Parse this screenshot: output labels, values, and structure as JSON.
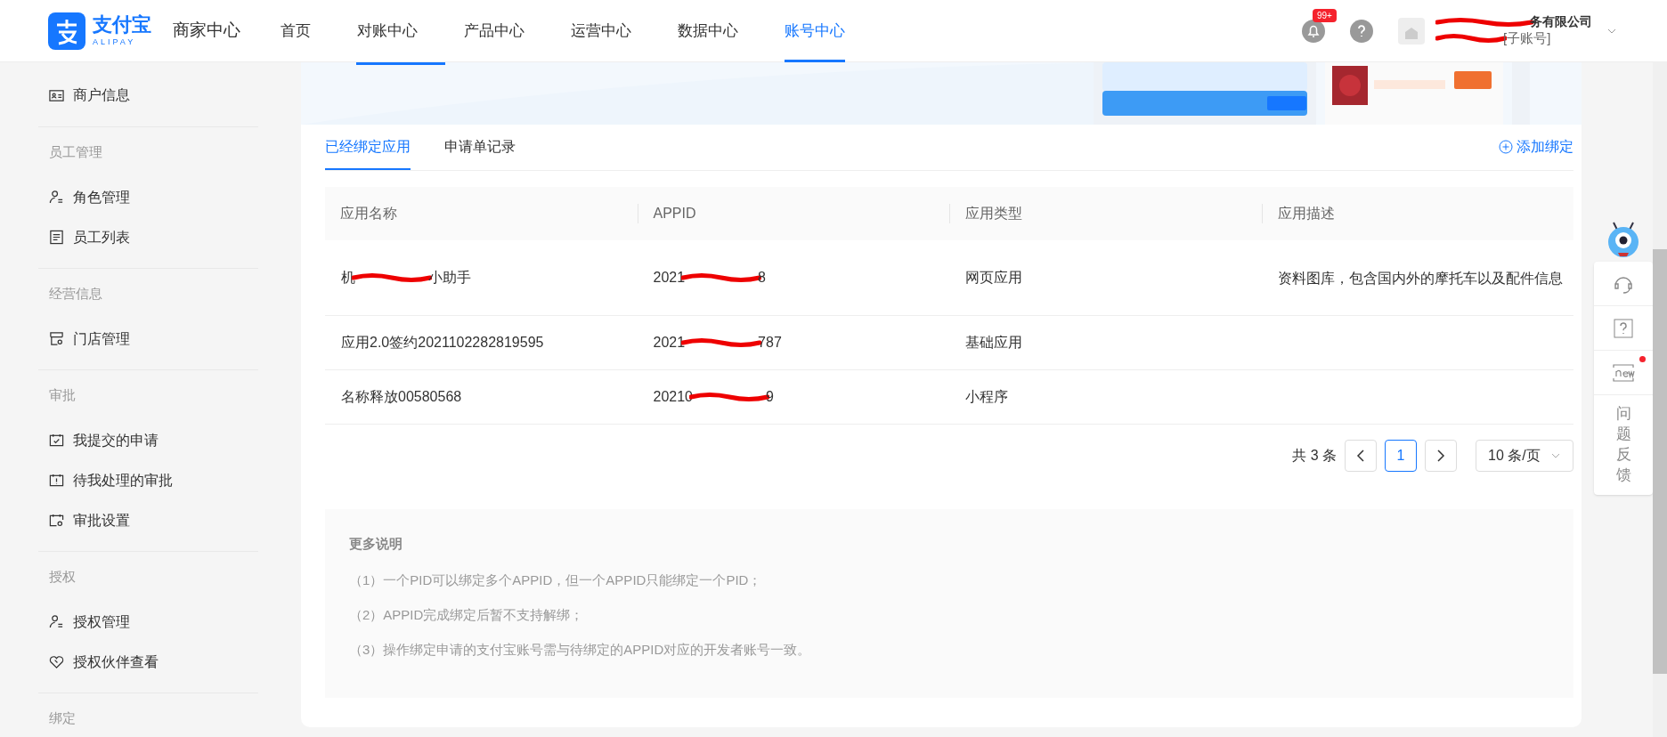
{
  "header": {
    "logo": {
      "name": "支付宝",
      "sub": "ALIPAY"
    },
    "title": "商家中心",
    "nav": [
      {
        "label": "首页",
        "selected": false
      },
      {
        "label": "对账中心",
        "selected": false
      },
      {
        "label": "产品中心",
        "selected": false
      },
      {
        "label": "运营中心",
        "selected": false
      },
      {
        "label": "数据中心",
        "selected": false
      },
      {
        "label": "账号中心",
        "selected": true
      }
    ],
    "notification_badge": "99+",
    "account": {
      "company_visible": "务有限公司",
      "role": "[子账号]"
    }
  },
  "sidebar": {
    "groups": [
      {
        "items": [
          {
            "label": "商户信息",
            "kind": "card"
          }
        ]
      },
      {
        "heading": "员工管理",
        "items": [
          {
            "label": "角色管理",
            "kind": "user"
          },
          {
            "label": "员工列表",
            "kind": "list"
          }
        ]
      },
      {
        "heading": "经营信息",
        "items": [
          {
            "label": "门店管理",
            "kind": "store"
          }
        ]
      },
      {
        "heading": "审批",
        "items": [
          {
            "label": "我提交的申请",
            "kind": "check"
          },
          {
            "label": "待我处理的审批",
            "kind": "alert"
          },
          {
            "label": "审批设置",
            "kind": "gear"
          }
        ]
      },
      {
        "heading": "授权",
        "items": [
          {
            "label": "授权管理",
            "kind": "user"
          },
          {
            "label": "授权伙伴查看",
            "kind": "heart"
          }
        ]
      },
      {
        "heading": "绑定"
      }
    ]
  },
  "tabs": [
    {
      "label": "已经绑定应用",
      "selected": true
    },
    {
      "label": "申请单记录",
      "selected": false
    }
  ],
  "add_button": "添加绑定",
  "table": {
    "columns": [
      "应用名称",
      "APPID",
      "应用类型",
      "应用描述"
    ],
    "rows": [
      {
        "name": [
          "机",
          "小助手"
        ],
        "appid": [
          "2021",
          "8"
        ],
        "type": "网页应用",
        "description": "资料图库，包含国内外的摩托车以及配件信息"
      },
      {
        "name": [
          "应用2.0签约2021102282819595"
        ],
        "appid": [
          "2021",
          "787"
        ],
        "type": "基础应用"
      },
      {
        "name": [
          "名称释放00580568"
        ],
        "appid": [
          "20210",
          "9"
        ],
        "type": "小程序"
      }
    ]
  },
  "pagination": {
    "total": "共 3 条",
    "pages": [
      {
        "label": "1",
        "selected": true
      }
    ],
    "page_size": "10 条/页"
  },
  "notes": {
    "title": "更多说明",
    "items": [
      "（1）一个PID可以绑定多个APPID，但一个APPID只能绑定一个PID；",
      "（2）APPID完成绑定后暂不支持解绑；",
      "（3）操作绑定申请的支付宝账号需与待绑定的APPID对应的开发者账号一致。"
    ]
  },
  "float_tools": {
    "feedback": "问题反馈",
    "new_dot": true
  }
}
